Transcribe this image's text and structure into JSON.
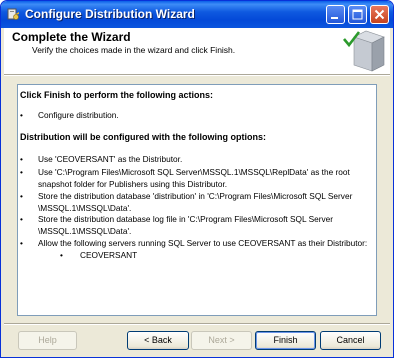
{
  "window": {
    "title": "Configure Distribution Wizard"
  },
  "header": {
    "title": "Complete the Wizard",
    "subtitle": "Verify the choices made in the wizard and click Finish."
  },
  "summary": {
    "actions_heading": "Click Finish to perform the following actions:",
    "actions": [
      "Configure distribution."
    ],
    "options_heading": "Distribution will be configured with the following options:",
    "options": [
      "Use 'CEOVERSANT' as the Distributor.",
      "Use 'C:\\Program Files\\Microsoft SQL Server\\MSSQL.1\\MSSQL\\ReplData' as the root snapshot folder for Publishers using this Distributor.",
      "Store the distribution database 'distribution' in 'C:\\Program Files\\Microsoft SQL Server \\MSSQL.1\\MSSQL\\Data'.",
      "Store the distribution database log file in 'C:\\Program Files\\Microsoft SQL Server \\MSSQL.1\\MSSQL\\Data'.",
      "Allow the following servers running SQL Server to use CEOVERSANT as their Distributor:"
    ],
    "servers": [
      "CEOVERSANT"
    ],
    "bullet": "•"
  },
  "buttons": {
    "help": "Help",
    "back": "< Back",
    "next": "Next >",
    "finish": "Finish",
    "cancel": "Cancel"
  },
  "colors": {
    "titlebar": "#0449d8",
    "dialog_bg": "#ece9d8",
    "border": "#0831d9"
  },
  "icons": [
    "app-icon",
    "minimize-icon",
    "maximize-icon",
    "close-icon",
    "wizard-server-icon"
  ]
}
